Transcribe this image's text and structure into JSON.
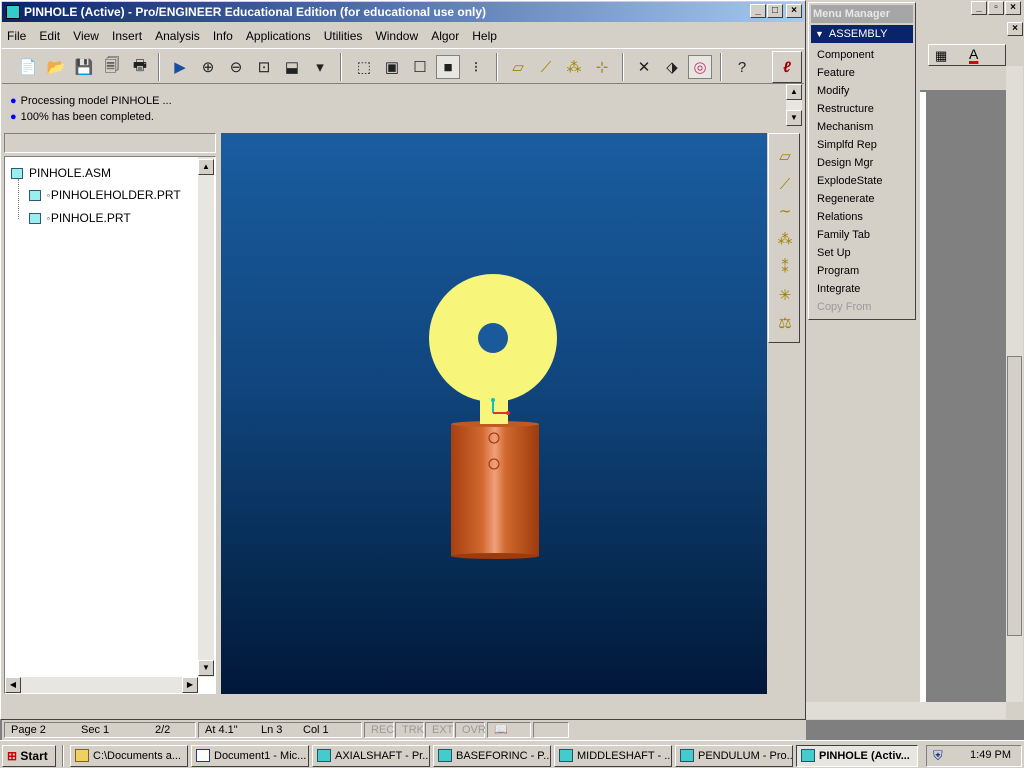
{
  "window": {
    "title": "PINHOLE (Active) - Pro/ENGINEER Educational Edition (for educational use only)"
  },
  "menubar": [
    "File",
    "Edit",
    "View",
    "Insert",
    "Analysis",
    "Info",
    "Applications",
    "Utilities",
    "Window",
    "Algor",
    "Help"
  ],
  "messages": [
    "Processing model PINHOLE ...",
    "100% has been completed."
  ],
  "model_tree": {
    "root": "PINHOLE.ASM",
    "children": [
      "PINHOLEHOLDER.PRT",
      "PINHOLE.PRT"
    ]
  },
  "menu_manager": {
    "title": "Menu Manager",
    "header": "ASSEMBLY",
    "items": [
      "Component",
      "Feature",
      "Modify",
      "Restructure",
      "Mechanism",
      "Simplfd Rep",
      "Design Mgr",
      "ExplodeState",
      "Regenerate",
      "Relations",
      "Family Tab",
      "Set Up",
      "Program",
      "Integrate",
      "Copy From"
    ],
    "disabled": [
      "Copy From"
    ]
  },
  "statusbar": {
    "page": "Page 2",
    "sec": "Sec 1",
    "pages": "2/2",
    "at": "At 4.1\"",
    "ln": "Ln 3",
    "col": "Col 1",
    "rec": "REC",
    "trk": "TRK",
    "ext": "EXT",
    "ovr": "OVR"
  },
  "taskbar": {
    "start": "Start",
    "tasks": [
      {
        "label": "C:\\Documents a...",
        "icon": "folder-icon"
      },
      {
        "label": "Document1 - Mic...",
        "icon": "word-icon"
      },
      {
        "label": "AXIALSHAFT - Pr...",
        "icon": "proe-icon"
      },
      {
        "label": "BASEFORINC - P...",
        "icon": "proe-icon"
      },
      {
        "label": "MIDDLESHAFT - ...",
        "icon": "proe-icon"
      },
      {
        "label": "PENDULUM - Pro...",
        "icon": "proe-icon"
      },
      {
        "label": "PINHOLE (Activ...",
        "icon": "proe-icon"
      }
    ],
    "clock": "1:49 PM"
  },
  "colors": {
    "pinhole_part": "#f7f67a",
    "holder_part": "#c0501a",
    "title_active": "#0a246a"
  }
}
